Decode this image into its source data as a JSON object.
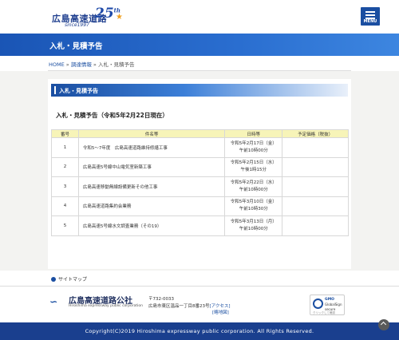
{
  "header": {
    "logo_text": "広島高速道路",
    "logo_since": "since1997",
    "logo_anniversary": "25",
    "logo_suffix": "th",
    "menu_label": "MENU"
  },
  "page": {
    "title": "入札・見積予告"
  },
  "breadcrumb": {
    "home": "HOME",
    "sep1": " » ",
    "parent": "調達情報",
    "sep2": " » ",
    "current": "入札・見積予告"
  },
  "section": {
    "heading": "入札・見積予告",
    "subheading": "入札・見積予告（令和5年2月22日現在）"
  },
  "table": {
    "headers": [
      "番号",
      "件名等",
      "日時等",
      "予定価格（税抜）"
    ],
    "rows": [
      {
        "no": "1",
        "name": "令和5～7年度　広島高速道路維持修繕工事",
        "date1": "令和5年2月17日（金）",
        "date2": "午前10時00分",
        "price": ""
      },
      {
        "no": "2",
        "name": "広島高速5号線中山電気室新築工事",
        "date1": "令和5年2月15日（水）",
        "date2": "午後1時15分",
        "price": ""
      },
      {
        "no": "3",
        "name": "広島高速移動無線設備更新その他工事",
        "date1": "令和5年2月22日（水）",
        "date2": "午前10時00分",
        "price": ""
      },
      {
        "no": "4",
        "name": "広島高速道路集約会業務",
        "date1": "令和5年3月10日（金）",
        "date2": "午前10時30分",
        "price": ""
      },
      {
        "no": "5",
        "name": "広島高速5号線水文調査業務（その19）",
        "date1": "令和5年3月13日（月）",
        "date2": "午前10時00分",
        "price": ""
      }
    ]
  },
  "sitemap_label": "サイトマップ",
  "footer": {
    "company": "広島高速道路公社",
    "company_en": "Hiroshima expressway public corporation",
    "zip": "〒732-0033",
    "address": "広島市東区温品一丁目8番23号",
    "access": "[アクセス]",
    "map": "[略地図]",
    "badge_line1": "GMO",
    "badge_line2": "GlobalSign",
    "badge_line3": "secure",
    "badge_line4": "クリックして確認",
    "copyright": "Copyright(C)2019 Hiroshima expressway public corporation. All Rights Reserved."
  },
  "colors": {
    "brand_blue": "#1a4ea1",
    "table_header": "#f7f4b8",
    "footer_bar": "#1a3f8e"
  }
}
